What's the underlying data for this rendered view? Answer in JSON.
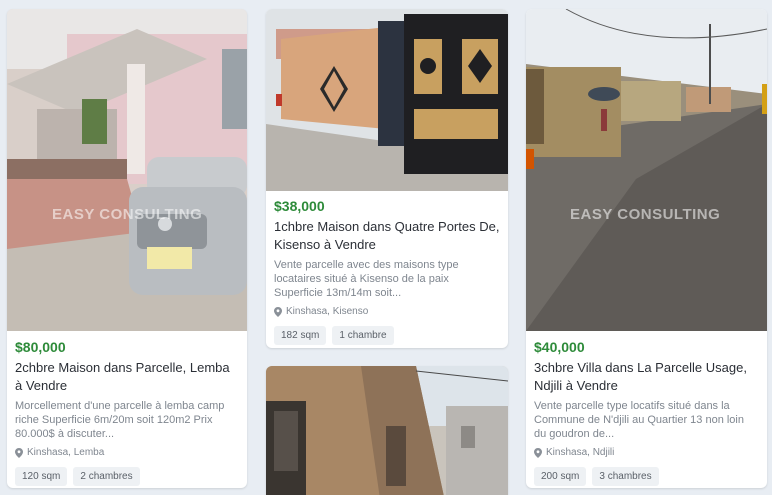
{
  "watermark": "EASY CONSULTING",
  "colors": {
    "price": "#2e8b3a",
    "page_bg": "#e8edf3",
    "chip_bg": "#eef1f4"
  },
  "listings": [
    {
      "price": "$80,000",
      "title": "2chbre Maison dans Parcelle, Lemba à Vendre",
      "description": "Morcellement d'une parcelle à lemba camp riche Superficie 6m/20m soit 120m2 Prix 80.000$ à discuter...",
      "location": "Kinshasa, Lemba",
      "area": "120 sqm",
      "rooms": "2 chambres",
      "image": "house-with-silver-mercedes-photo"
    },
    {
      "price": "$38,000",
      "title": "1chbre Maison dans Quatre Portes De, Kisenso à Vendre",
      "description": "Vente parcelle avec des maisons type locataires situé à Kisenso de la paix Superficie 13m/14m soit...",
      "location": "Kinshasa, Kisenso",
      "area": "182 sqm",
      "rooms": "1 chambre",
      "image": "gated-wall-photo"
    },
    {
      "price": "$40,000",
      "title": "3chbre Villa dans La Parcelle Usage, Ndjili à Vendre",
      "description": "Vente parcelle type locatifs situé dans la Commune de N'djili au Quartier 13 non loin du goudron de...",
      "location": "Kinshasa, Ndjili",
      "area": "200 sqm",
      "rooms": "3 chambres",
      "image": "street-photo"
    },
    {
      "image": "brick-building-photo"
    }
  ]
}
